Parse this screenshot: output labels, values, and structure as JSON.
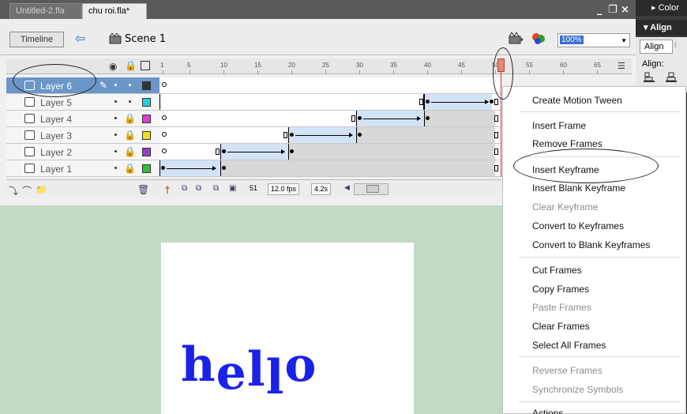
{
  "tabs": [
    "Untitled-2.fla",
    "chu roi.fla*"
  ],
  "window_controls": [
    "_",
    "ə",
    "×"
  ],
  "edit_bar": {
    "timeline_label": "Timeline",
    "scene_label": "Scene 1",
    "zoom_value": "100%"
  },
  "right_panel": {
    "color_header": "Color",
    "align_header": "Align",
    "align_tab": "Align",
    "align_label": "Align:"
  },
  "ruler_ticks": [
    "1",
    "5",
    "10",
    "15",
    "20",
    "25",
    "30",
    "35",
    "40",
    "45",
    "50",
    "55",
    "60",
    "65"
  ],
  "layers": [
    {
      "name": "Layer 6",
      "color": "#333333",
      "selected": true
    },
    {
      "name": "Layer 5",
      "color": "#22d0e0"
    },
    {
      "name": "Layer 4",
      "color": "#e23bd4"
    },
    {
      "name": "Layer 3",
      "color": "#f0e020"
    },
    {
      "name": "Layer 2",
      "color": "#9a40c8"
    },
    {
      "name": "Layer 1",
      "color": "#30c030"
    }
  ],
  "footer": {
    "current_frame": "51",
    "frame_rate": "12.0 fps",
    "elapsed_time": "4.2s"
  },
  "stage": {
    "text_letters": [
      "h",
      "e",
      "l",
      "l",
      "o"
    ],
    "text_color": "#1a22e8"
  },
  "context_menu": {
    "items": [
      {
        "label": "Create Motion Tween",
        "enabled": true
      },
      {
        "label": "Insert Frame",
        "enabled": true
      },
      {
        "label": "Remove Frames",
        "enabled": true
      },
      {
        "label": "Insert Keyframe",
        "enabled": true
      },
      {
        "label": "Insert Blank Keyframe",
        "enabled": true
      },
      {
        "label": "Clear Keyframe",
        "enabled": false
      },
      {
        "label": "Convert to Keyframes",
        "enabled": true
      },
      {
        "label": "Convert to Blank Keyframes",
        "enabled": true
      },
      {
        "label": "Cut Frames",
        "enabled": true
      },
      {
        "label": "Copy Frames",
        "enabled": true
      },
      {
        "label": "Paste Frames",
        "enabled": false
      },
      {
        "label": "Clear Frames",
        "enabled": true
      },
      {
        "label": "Select All Frames",
        "enabled": true
      },
      {
        "label": "Reverse Frames",
        "enabled": false
      },
      {
        "label": "Synchronize Symbols",
        "enabled": false
      },
      {
        "label": "Actions",
        "enabled": true
      }
    ]
  }
}
